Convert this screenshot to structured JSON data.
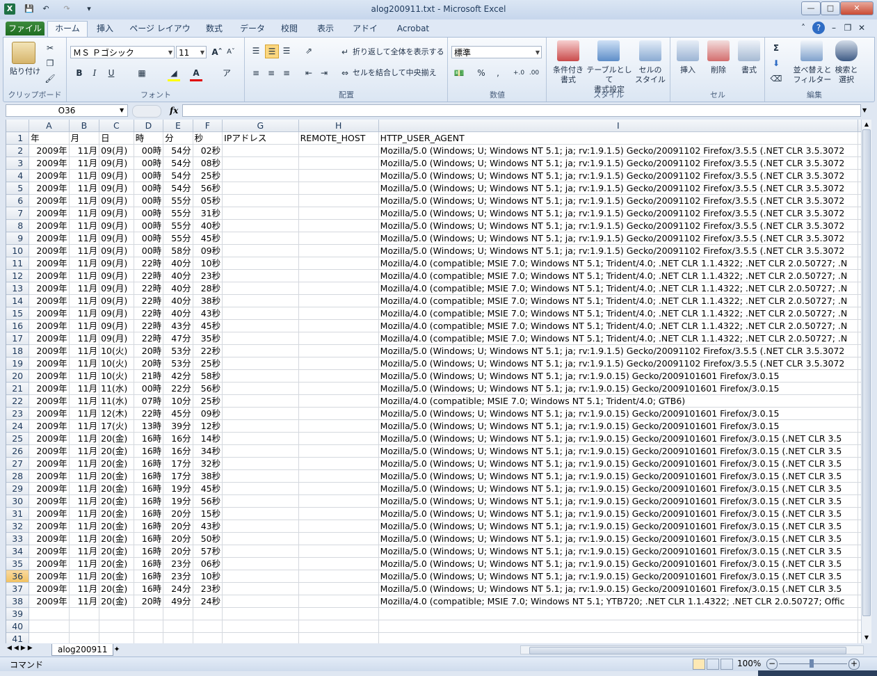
{
  "window": {
    "title": "alog200911.txt - Microsoft Excel"
  },
  "tabs": [
    "ファイル",
    "ホーム",
    "挿入",
    "ページ レイアウト",
    "数式",
    "データ",
    "校閲",
    "表示",
    "アドイン",
    "Acrobat"
  ],
  "ribbon": {
    "clipboard": {
      "paste": "貼り付け",
      "label": "クリップボード"
    },
    "font": {
      "name": "ＭＳ Ｐゴシック",
      "size": "11",
      "bold": "B",
      "italic": "I",
      "underline": "U",
      "label": "フォント"
    },
    "alignment": {
      "wrap": "折り返して全体を表示する",
      "merge": "セルを結合して中央揃え",
      "label": "配置"
    },
    "number": {
      "format": "標準",
      "percent": "%",
      "comma": ",",
      "label": "数値"
    },
    "styles": {
      "conditional": "条件付き\n書式",
      "table": "テーブルとして\n書式設定",
      "cell": "セルの\nスタイル",
      "label": "スタイル"
    },
    "cells": {
      "insert": "挿入",
      "delete": "削除",
      "format": "書式",
      "label": "セル"
    },
    "editing": {
      "sort": "並べ替えと\nフィルター",
      "find": "検索と\n選択",
      "sum": "Σ",
      "label": "編集"
    }
  },
  "formula_bar": {
    "name_box": "O36",
    "fx": "fx",
    "value": ""
  },
  "columns": [
    "A",
    "B",
    "C",
    "D",
    "E",
    "F",
    "G",
    "H",
    "I"
  ],
  "header_row": [
    "年",
    "月",
    "日",
    "時",
    "分",
    "秒",
    "IPアドレス",
    "REMOTE_HOST",
    "HTTP_USER_AGENT"
  ],
  "rows": [
    [
      "2009年",
      "11月",
      "09(月)",
      "00時",
      "54分",
      "02秒",
      "",
      "",
      "Mozilla/5.0 (Windows; U; Windows NT 5.1; ja; rv:1.9.1.5) Gecko/20091102 Firefox/3.5.5 (.NET CLR 3.5.3072"
    ],
    [
      "2009年",
      "11月",
      "09(月)",
      "00時",
      "54分",
      "08秒",
      "",
      "",
      "Mozilla/5.0 (Windows; U; Windows NT 5.1; ja; rv:1.9.1.5) Gecko/20091102 Firefox/3.5.5 (.NET CLR 3.5.3072"
    ],
    [
      "2009年",
      "11月",
      "09(月)",
      "00時",
      "54分",
      "25秒",
      "",
      "",
      "Mozilla/5.0 (Windows; U; Windows NT 5.1; ja; rv:1.9.1.5) Gecko/20091102 Firefox/3.5.5 (.NET CLR 3.5.3072"
    ],
    [
      "2009年",
      "11月",
      "09(月)",
      "00時",
      "54分",
      "56秒",
      "",
      "",
      "Mozilla/5.0 (Windows; U; Windows NT 5.1; ja; rv:1.9.1.5) Gecko/20091102 Firefox/3.5.5 (.NET CLR 3.5.3072"
    ],
    [
      "2009年",
      "11月",
      "09(月)",
      "00時",
      "55分",
      "05秒",
      "",
      "",
      "Mozilla/5.0 (Windows; U; Windows NT 5.1; ja; rv:1.9.1.5) Gecko/20091102 Firefox/3.5.5 (.NET CLR 3.5.3072"
    ],
    [
      "2009年",
      "11月",
      "09(月)",
      "00時",
      "55分",
      "31秒",
      "",
      "",
      "Mozilla/5.0 (Windows; U; Windows NT 5.1; ja; rv:1.9.1.5) Gecko/20091102 Firefox/3.5.5 (.NET CLR 3.5.3072"
    ],
    [
      "2009年",
      "11月",
      "09(月)",
      "00時",
      "55分",
      "40秒",
      "",
      "",
      "Mozilla/5.0 (Windows; U; Windows NT 5.1; ja; rv:1.9.1.5) Gecko/20091102 Firefox/3.5.5 (.NET CLR 3.5.3072"
    ],
    [
      "2009年",
      "11月",
      "09(月)",
      "00時",
      "55分",
      "45秒",
      "",
      "",
      "Mozilla/5.0 (Windows; U; Windows NT 5.1; ja; rv:1.9.1.5) Gecko/20091102 Firefox/3.5.5 (.NET CLR 3.5.3072"
    ],
    [
      "2009年",
      "11月",
      "09(月)",
      "00時",
      "58分",
      "09秒",
      "",
      "",
      "Mozilla/5.0 (Windows; U; Windows NT 5.1; ja; rv:1.9.1.5) Gecko/20091102 Firefox/3.5.5 (.NET CLR 3.5.3072"
    ],
    [
      "2009年",
      "11月",
      "09(月)",
      "22時",
      "40分",
      "10秒",
      "",
      "",
      "Mozilla/4.0 (compatible; MSIE 7.0; Windows NT 5.1; Trident/4.0; .NET CLR 1.1.4322; .NET CLR 2.0.50727; .N"
    ],
    [
      "2009年",
      "11月",
      "09(月)",
      "22時",
      "40分",
      "23秒",
      "",
      "",
      "Mozilla/4.0 (compatible; MSIE 7.0; Windows NT 5.1; Trident/4.0; .NET CLR 1.1.4322; .NET CLR 2.0.50727; .N"
    ],
    [
      "2009年",
      "11月",
      "09(月)",
      "22時",
      "40分",
      "28秒",
      "",
      "",
      "Mozilla/4.0 (compatible; MSIE 7.0; Windows NT 5.1; Trident/4.0; .NET CLR 1.1.4322; .NET CLR 2.0.50727; .N"
    ],
    [
      "2009年",
      "11月",
      "09(月)",
      "22時",
      "40分",
      "38秒",
      "",
      "",
      "Mozilla/4.0 (compatible; MSIE 7.0; Windows NT 5.1; Trident/4.0; .NET CLR 1.1.4322; .NET CLR 2.0.50727; .N"
    ],
    [
      "2009年",
      "11月",
      "09(月)",
      "22時",
      "40分",
      "43秒",
      "",
      "",
      "Mozilla/4.0 (compatible; MSIE 7.0; Windows NT 5.1; Trident/4.0; .NET CLR 1.1.4322; .NET CLR 2.0.50727; .N"
    ],
    [
      "2009年",
      "11月",
      "09(月)",
      "22時",
      "43分",
      "45秒",
      "",
      "",
      "Mozilla/4.0 (compatible; MSIE 7.0; Windows NT 5.1; Trident/4.0; .NET CLR 1.1.4322; .NET CLR 2.0.50727; .N"
    ],
    [
      "2009年",
      "11月",
      "09(月)",
      "22時",
      "47分",
      "35秒",
      "",
      "",
      "Mozilla/4.0 (compatible; MSIE 7.0; Windows NT 5.1; Trident/4.0; .NET CLR 1.1.4322; .NET CLR 2.0.50727; .N"
    ],
    [
      "2009年",
      "11月",
      "10(火)",
      "20時",
      "53分",
      "22秒",
      "",
      "",
      "Mozilla/5.0 (Windows; U; Windows NT 5.1; ja; rv:1.9.1.5) Gecko/20091102 Firefox/3.5.5 (.NET CLR 3.5.3072"
    ],
    [
      "2009年",
      "11月",
      "10(火)",
      "20時",
      "53分",
      "25秒",
      "",
      "",
      "Mozilla/5.0 (Windows; U; Windows NT 5.1; ja; rv:1.9.1.5) Gecko/20091102 Firefox/3.5.5 (.NET CLR 3.5.3072"
    ],
    [
      "2009年",
      "11月",
      "10(火)",
      "21時",
      "42分",
      "58秒",
      "",
      "",
      "Mozilla/5.0 (Windows; U; Windows NT 5.1; ja; rv:1.9.0.15) Gecko/2009101601 Firefox/3.0.15"
    ],
    [
      "2009年",
      "11月",
      "11(水)",
      "00時",
      "22分",
      "56秒",
      "",
      "",
      "Mozilla/5.0 (Windows; U; Windows NT 5.1; ja; rv:1.9.0.15) Gecko/2009101601 Firefox/3.0.15"
    ],
    [
      "2009年",
      "11月",
      "11(水)",
      "07時",
      "10分",
      "25秒",
      "",
      "",
      "Mozilla/4.0 (compatible; MSIE 7.0; Windows NT 5.1; Trident/4.0; GTB6)"
    ],
    [
      "2009年",
      "11月",
      "12(木)",
      "22時",
      "45分",
      "09秒",
      "",
      "",
      "Mozilla/5.0 (Windows; U; Windows NT 5.1; ja; rv:1.9.0.15) Gecko/2009101601 Firefox/3.0.15"
    ],
    [
      "2009年",
      "11月",
      "17(火)",
      "13時",
      "39分",
      "12秒",
      "",
      "",
      "Mozilla/5.0 (Windows; U; Windows NT 5.1; ja; rv:1.9.0.15) Gecko/2009101601 Firefox/3.0.15"
    ],
    [
      "2009年",
      "11月",
      "20(金)",
      "16時",
      "16分",
      "14秒",
      "",
      "",
      "Mozilla/5.0 (Windows; U; Windows NT 5.1; ja; rv:1.9.0.15) Gecko/2009101601 Firefox/3.0.15 (.NET CLR 3.5"
    ],
    [
      "2009年",
      "11月",
      "20(金)",
      "16時",
      "16分",
      "34秒",
      "",
      "",
      "Mozilla/5.0 (Windows; U; Windows NT 5.1; ja; rv:1.9.0.15) Gecko/2009101601 Firefox/3.0.15 (.NET CLR 3.5"
    ],
    [
      "2009年",
      "11月",
      "20(金)",
      "16時",
      "17分",
      "32秒",
      "",
      "",
      "Mozilla/5.0 (Windows; U; Windows NT 5.1; ja; rv:1.9.0.15) Gecko/2009101601 Firefox/3.0.15 (.NET CLR 3.5"
    ],
    [
      "2009年",
      "11月",
      "20(金)",
      "16時",
      "17分",
      "38秒",
      "",
      "",
      "Mozilla/5.0 (Windows; U; Windows NT 5.1; ja; rv:1.9.0.15) Gecko/2009101601 Firefox/3.0.15 (.NET CLR 3.5"
    ],
    [
      "2009年",
      "11月",
      "20(金)",
      "16時",
      "19分",
      "45秒",
      "",
      "",
      "Mozilla/5.0 (Windows; U; Windows NT 5.1; ja; rv:1.9.0.15) Gecko/2009101601 Firefox/3.0.15 (.NET CLR 3.5"
    ],
    [
      "2009年",
      "11月",
      "20(金)",
      "16時",
      "19分",
      "56秒",
      "",
      "",
      "Mozilla/5.0 (Windows; U; Windows NT 5.1; ja; rv:1.9.0.15) Gecko/2009101601 Firefox/3.0.15 (.NET CLR 3.5"
    ],
    [
      "2009年",
      "11月",
      "20(金)",
      "16時",
      "20分",
      "15秒",
      "",
      "",
      "Mozilla/5.0 (Windows; U; Windows NT 5.1; ja; rv:1.9.0.15) Gecko/2009101601 Firefox/3.0.15 (.NET CLR 3.5"
    ],
    [
      "2009年",
      "11月",
      "20(金)",
      "16時",
      "20分",
      "43秒",
      "",
      "",
      "Mozilla/5.0 (Windows; U; Windows NT 5.1; ja; rv:1.9.0.15) Gecko/2009101601 Firefox/3.0.15 (.NET CLR 3.5"
    ],
    [
      "2009年",
      "11月",
      "20(金)",
      "16時",
      "20分",
      "50秒",
      "",
      "",
      "Mozilla/5.0 (Windows; U; Windows NT 5.1; ja; rv:1.9.0.15) Gecko/2009101601 Firefox/3.0.15 (.NET CLR 3.5"
    ],
    [
      "2009年",
      "11月",
      "20(金)",
      "16時",
      "20分",
      "57秒",
      "",
      "",
      "Mozilla/5.0 (Windows; U; Windows NT 5.1; ja; rv:1.9.0.15) Gecko/2009101601 Firefox/3.0.15 (.NET CLR 3.5"
    ],
    [
      "2009年",
      "11月",
      "20(金)",
      "16時",
      "23分",
      "06秒",
      "",
      "",
      "Mozilla/5.0 (Windows; U; Windows NT 5.1; ja; rv:1.9.0.15) Gecko/2009101601 Firefox/3.0.15 (.NET CLR 3.5"
    ],
    [
      "2009年",
      "11月",
      "20(金)",
      "16時",
      "23分",
      "10秒",
      "",
      "",
      "Mozilla/5.0 (Windows; U; Windows NT 5.1; ja; rv:1.9.0.15) Gecko/2009101601 Firefox/3.0.15 (.NET CLR 3.5"
    ],
    [
      "2009年",
      "11月",
      "20(金)",
      "16時",
      "24分",
      "23秒",
      "",
      "",
      "Mozilla/5.0 (Windows; U; Windows NT 5.1; ja; rv:1.9.0.15) Gecko/2009101601 Firefox/3.0.15 (.NET CLR 3.5"
    ],
    [
      "2009年",
      "11月",
      "20(金)",
      "20時",
      "49分",
      "24秒",
      "",
      "",
      "Mozilla/4.0 (compatible; MSIE 7.0; Windows NT 5.1; YTB720; .NET CLR 1.1.4322; .NET CLR 2.0.50727; Offic"
    ]
  ],
  "empty_row_numbers": [
    "39",
    "40",
    "41"
  ],
  "selected_row": "36",
  "sheet_tab": "alog200911",
  "status": {
    "mode": "コマンド",
    "zoom": "100%"
  }
}
